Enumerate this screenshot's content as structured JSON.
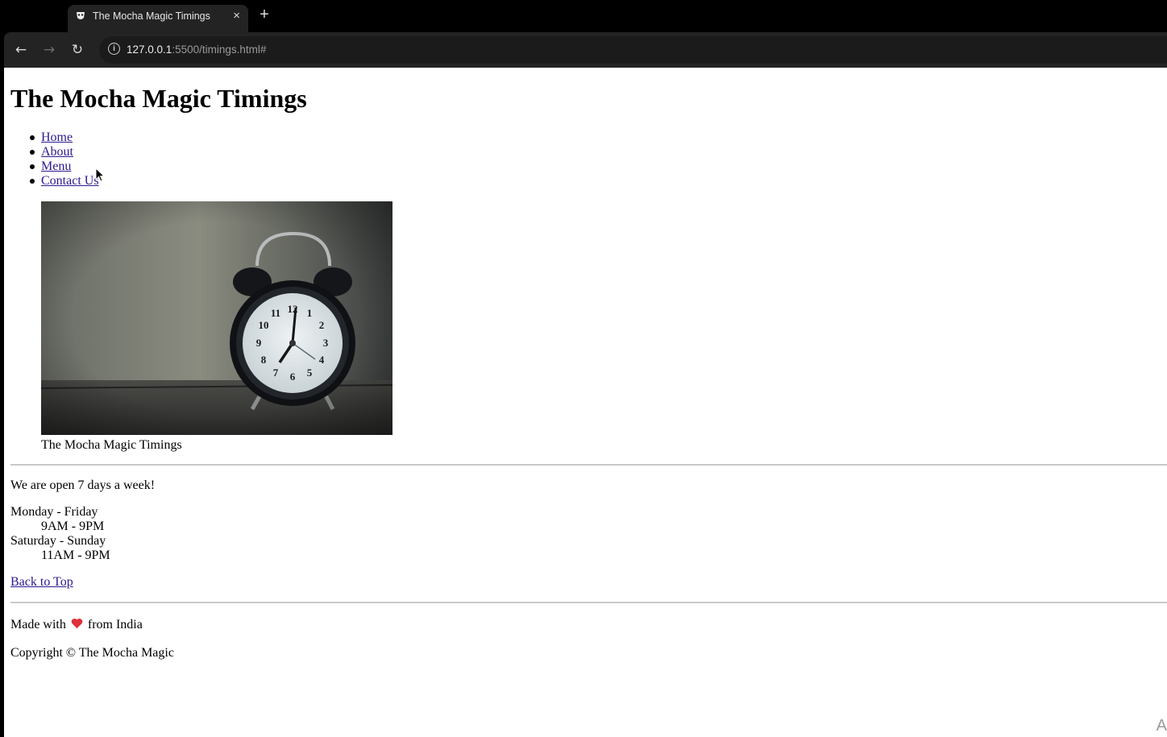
{
  "browser": {
    "tab_title": "The Mocha Magic Timings",
    "tab_close": "×",
    "new_tab": "+",
    "url_host": "127.0.0.1",
    "url_rest": ":5500/timings.html#",
    "info_icon": "i"
  },
  "page": {
    "heading": "The Mocha Magic Timings",
    "nav": [
      "Home",
      "About",
      "Menu",
      "Contact Us"
    ],
    "figure_caption": "The Mocha Magic Timings",
    "open_text": "We are open 7 days a week!",
    "schedule": [
      {
        "days": "Monday - Friday",
        "hours": "9AM - 9PM"
      },
      {
        "days": "Saturday - Sunday",
        "hours": "11AM - 9PM"
      }
    ],
    "back_to_top": "Back to Top",
    "made_with_before": "Made with",
    "made_with_after": "from India",
    "copyright": "Copyright © The Mocha Magic"
  },
  "colors": {
    "link": "#2a1a8f",
    "heart": "#e0303a"
  }
}
